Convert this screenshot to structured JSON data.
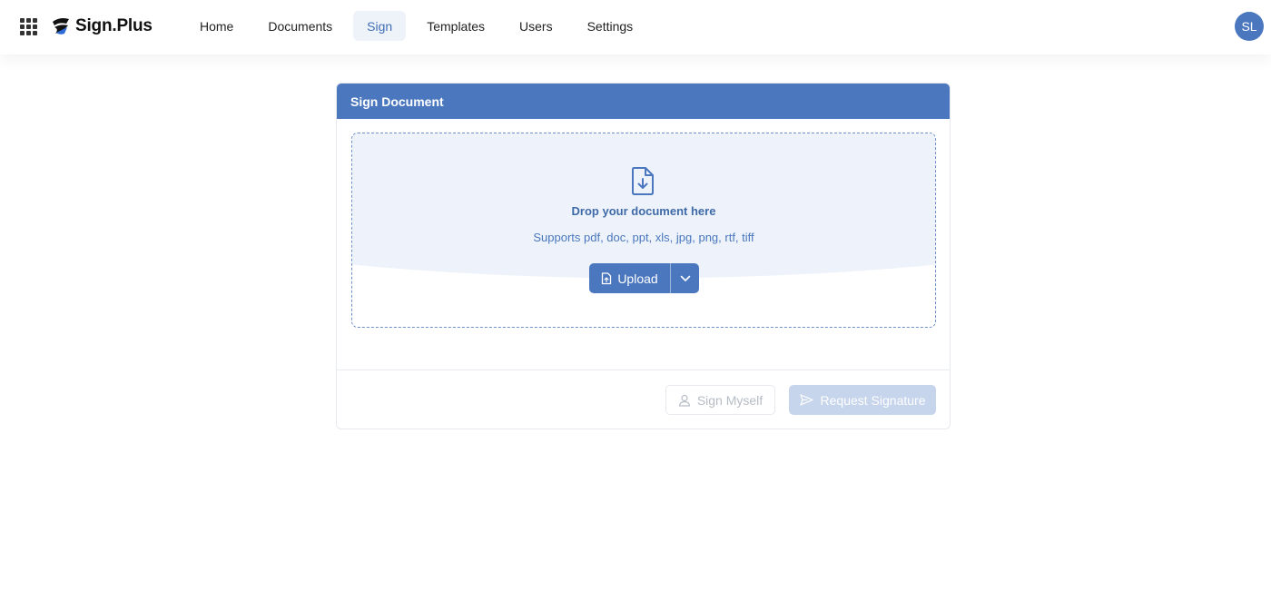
{
  "app": {
    "logo_text": "Sign.Plus",
    "brand_color": "#4a77be"
  },
  "nav": {
    "items": [
      {
        "label": "Home"
      },
      {
        "label": "Documents"
      },
      {
        "label": "Sign",
        "active": true
      },
      {
        "label": "Templates"
      },
      {
        "label": "Users"
      },
      {
        "label": "Settings"
      }
    ]
  },
  "user": {
    "initials": "SL"
  },
  "card": {
    "title": "Sign Document",
    "dropzone": {
      "title": "Drop your document here",
      "subtitle": "Supports pdf, doc, ppt, xls, jpg, png, rtf, tiff",
      "icon": "document-download-icon"
    },
    "upload_label": "Upload",
    "sign_myself_label": "Sign Myself",
    "request_signature_label": "Request Signature"
  },
  "icons": {
    "apps": "apps-grid-icon",
    "upload": "file-upload-icon",
    "caret": "chevron-down-icon",
    "user": "user-icon",
    "send": "send-icon"
  }
}
